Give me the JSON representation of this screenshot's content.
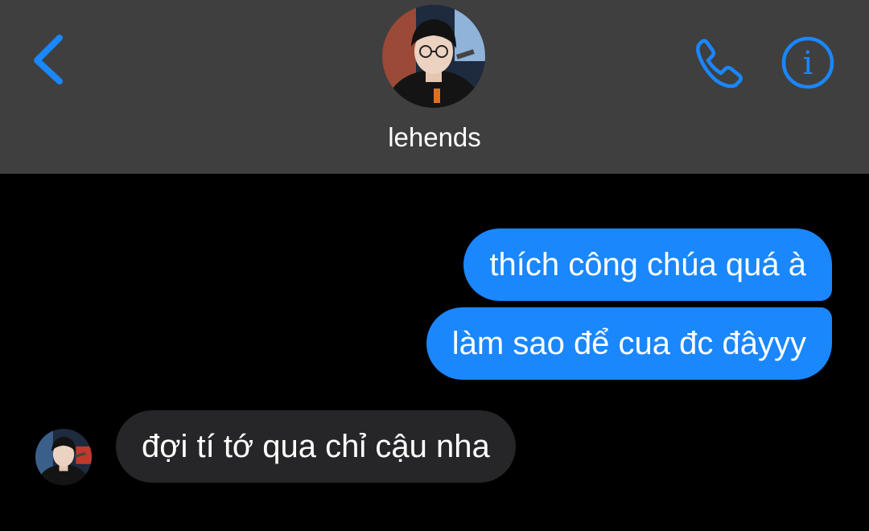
{
  "header": {
    "contact_name": "lehends",
    "back_icon": "chevron-left-icon",
    "call_icon": "phone-icon",
    "info_icon": "info-circle-icon",
    "info_glyph": "i"
  },
  "colors": {
    "accent": "#1a87fd",
    "header_bg": "#3f3f3f",
    "chat_bg": "#000000",
    "incoming_bubble": "#262628",
    "text": "#ffffff"
  },
  "messages": [
    {
      "direction": "outgoing",
      "text": "thích công chúa quá à"
    },
    {
      "direction": "outgoing",
      "text": "làm sao để cua đc đâyyy"
    },
    {
      "direction": "incoming",
      "text": "đợi tí tớ qua chỉ cậu nha"
    }
  ]
}
